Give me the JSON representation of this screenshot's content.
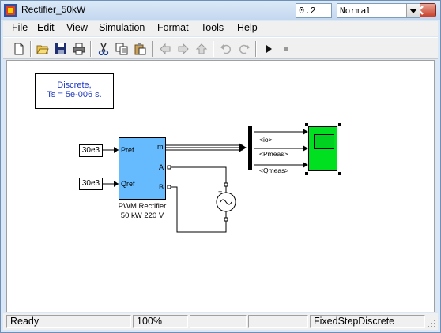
{
  "window": {
    "title": "Rectifier_50kW"
  },
  "menu": [
    "File",
    "Edit",
    "View",
    "Simulation",
    "Format",
    "Tools",
    "Help"
  ],
  "toolbar": {
    "stop_time": "0.2",
    "sim_mode": "Normal"
  },
  "model": {
    "powergui": {
      "line1": "Discrete,",
      "line2": "Ts = 5e-006 s."
    },
    "const_p": "30e3",
    "const_q": "30e3",
    "rectifier": {
      "ports_in": [
        "Pref",
        "Qref"
      ],
      "ports_out": [
        "m",
        "A",
        "B"
      ],
      "caption1": "PWM Rectifier",
      "caption2": "50 kW 220 V"
    },
    "signals": [
      "<io>",
      "<Pmeas>",
      "<Qmeas>"
    ]
  },
  "status": {
    "state": "Ready",
    "zoom": "100%",
    "solver": "FixedStepDiscrete"
  }
}
